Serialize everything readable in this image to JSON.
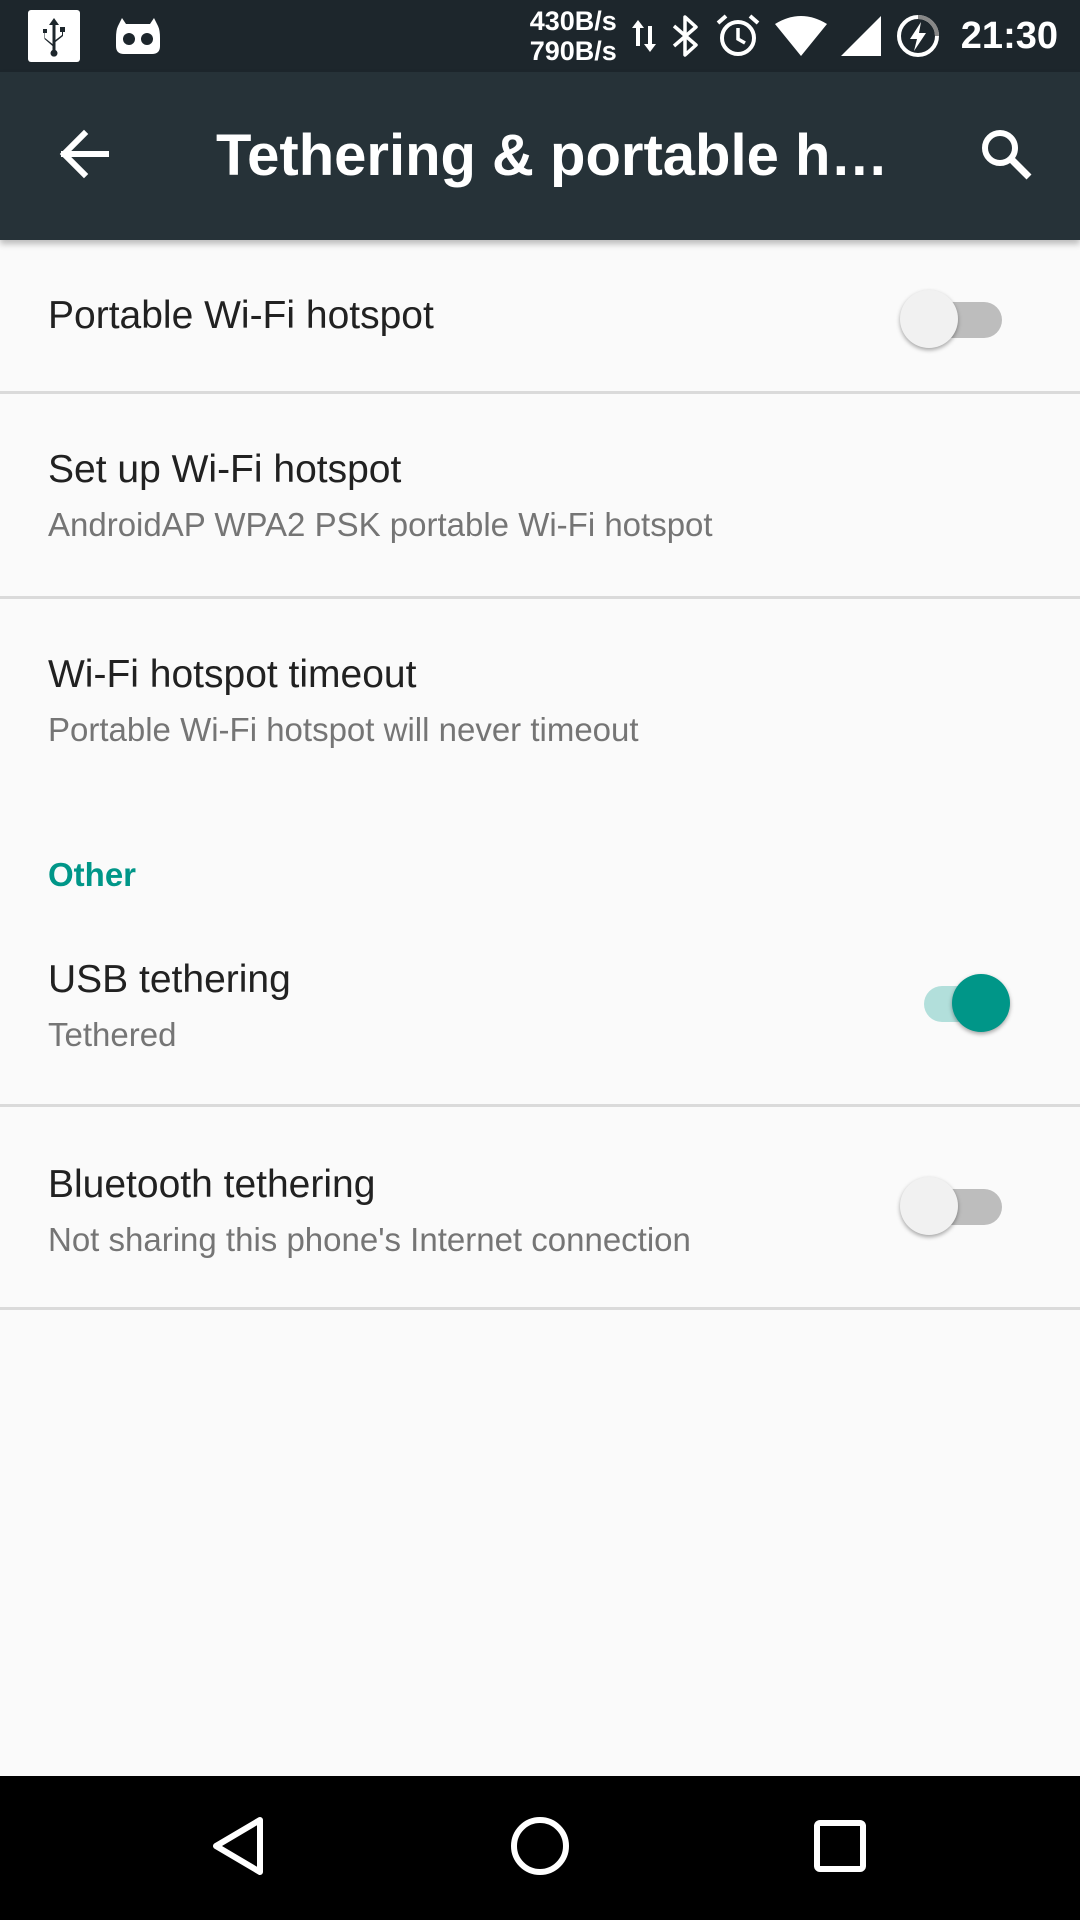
{
  "status_bar": {
    "download_speed": "430B/s",
    "upload_speed": "790B/s",
    "time": "21:30",
    "icons": [
      "usb-icon",
      "cyanogen-icon",
      "data-arrows-icon",
      "bluetooth-icon",
      "alarm-icon",
      "wifi-icon",
      "cell-signal-icon",
      "battery-charging-icon"
    ]
  },
  "app_bar": {
    "title": "Tethering & portable hot…",
    "back_icon": "arrow-back-icon",
    "search_icon": "search-icon"
  },
  "settings": {
    "wifi_hotspot": {
      "title": "Portable Wi-Fi hotspot",
      "enabled": false
    },
    "setup_hotspot": {
      "title": "Set up Wi-Fi hotspot",
      "summary": "AndroidAP WPA2 PSK portable Wi-Fi hotspot"
    },
    "hotspot_timeout": {
      "title": "Wi-Fi hotspot timeout",
      "summary": "Portable Wi-Fi hotspot will never timeout"
    },
    "other_category": "Other",
    "usb_tethering": {
      "title": "USB tethering",
      "summary": "Tethered",
      "enabled": true
    },
    "bluetooth_tethering": {
      "title": "Bluetooth tethering",
      "summary": "Not sharing this phone's Internet connection",
      "enabled": false
    }
  },
  "colors": {
    "accent": "#009688",
    "toolbar": "#263238",
    "status_bar": "#1d262c",
    "background": "#fafafa"
  },
  "nav_bar": {
    "icons": [
      "back-triangle-icon",
      "home-circle-icon",
      "recents-square-icon"
    ]
  }
}
